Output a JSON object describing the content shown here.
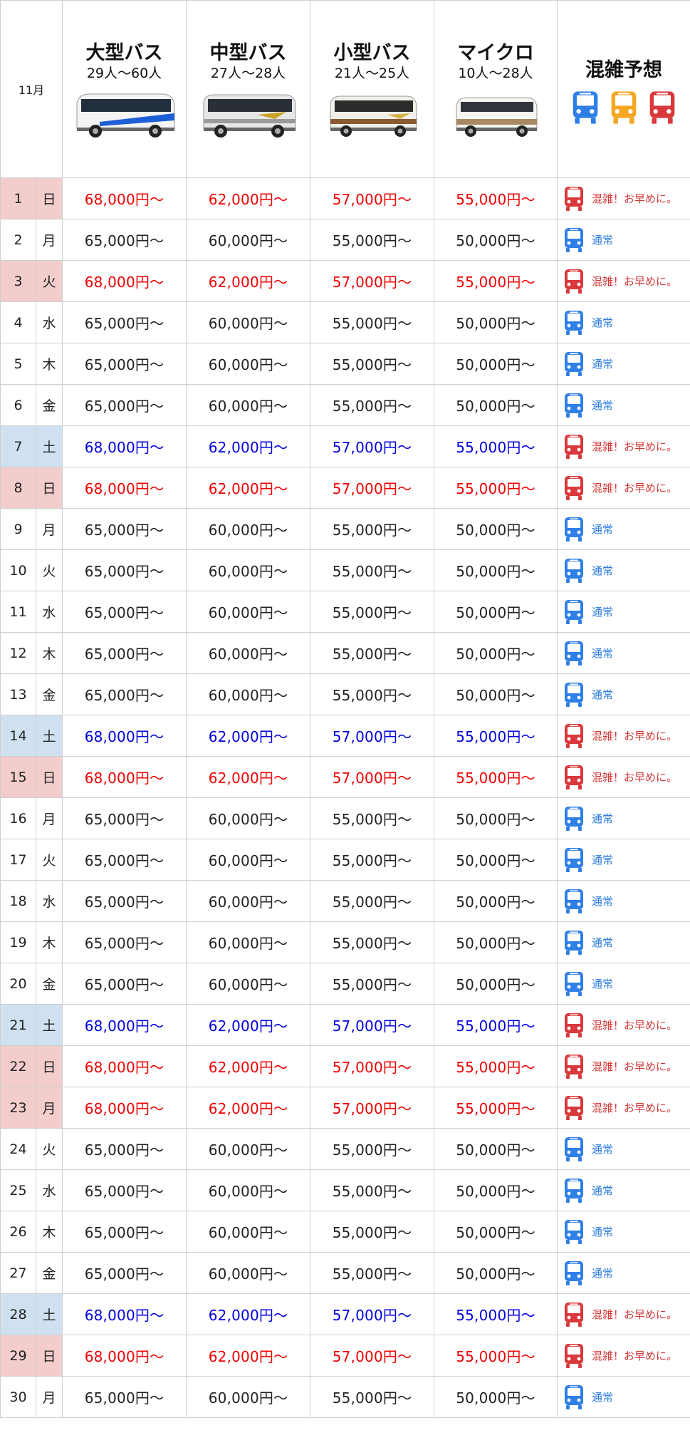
{
  "header": {
    "month": "11月",
    "congestion_title": "混雑予想",
    "buses": [
      {
        "name": "大型バス",
        "capacity": "29人〜60人"
      },
      {
        "name": "中型バス",
        "capacity": "27人〜28人"
      },
      {
        "name": "小型バス",
        "capacity": "21人〜25人"
      },
      {
        "name": "マイクロ",
        "capacity": "10人〜28人"
      }
    ],
    "legend_colors": [
      "#2f80e6",
      "#f5a623",
      "#d9393c"
    ]
  },
  "price_sets": {
    "busy": [
      "68,000円〜",
      "62,000円〜",
      "57,000円〜",
      "55,000円〜"
    ],
    "normal": [
      "65,000円〜",
      "60,000円〜",
      "55,000円〜",
      "50,000円〜"
    ]
  },
  "status_labels": {
    "busy": "混雑！お早めに。",
    "normal": "通常"
  },
  "colors": {
    "sunday_holiday_text": "#f00000",
    "saturday_text": "#0000e0",
    "sunday_holiday_bg": "#f3cccc",
    "saturday_bg": "#cfe1f1",
    "busy_icon": "#d9393c",
    "normal_icon": "#2f80e6"
  },
  "days": [
    {
      "day": "1",
      "weekday": "日",
      "type": "sun"
    },
    {
      "day": "2",
      "weekday": "月",
      "type": "normal"
    },
    {
      "day": "3",
      "weekday": "火",
      "type": "sun"
    },
    {
      "day": "4",
      "weekday": "水",
      "type": "normal"
    },
    {
      "day": "5",
      "weekday": "木",
      "type": "normal"
    },
    {
      "day": "6",
      "weekday": "金",
      "type": "normal"
    },
    {
      "day": "7",
      "weekday": "土",
      "type": "sat"
    },
    {
      "day": "8",
      "weekday": "日",
      "type": "sun"
    },
    {
      "day": "9",
      "weekday": "月",
      "type": "normal"
    },
    {
      "day": "10",
      "weekday": "火",
      "type": "normal"
    },
    {
      "day": "11",
      "weekday": "水",
      "type": "normal"
    },
    {
      "day": "12",
      "weekday": "木",
      "type": "normal"
    },
    {
      "day": "13",
      "weekday": "金",
      "type": "normal"
    },
    {
      "day": "14",
      "weekday": "土",
      "type": "sat"
    },
    {
      "day": "15",
      "weekday": "日",
      "type": "sun"
    },
    {
      "day": "16",
      "weekday": "月",
      "type": "normal"
    },
    {
      "day": "17",
      "weekday": "火",
      "type": "normal"
    },
    {
      "day": "18",
      "weekday": "水",
      "type": "normal"
    },
    {
      "day": "19",
      "weekday": "木",
      "type": "normal"
    },
    {
      "day": "20",
      "weekday": "金",
      "type": "normal"
    },
    {
      "day": "21",
      "weekday": "土",
      "type": "sat"
    },
    {
      "day": "22",
      "weekday": "日",
      "type": "sun"
    },
    {
      "day": "23",
      "weekday": "月",
      "type": "sun"
    },
    {
      "day": "24",
      "weekday": "火",
      "type": "normal"
    },
    {
      "day": "25",
      "weekday": "水",
      "type": "normal"
    },
    {
      "day": "26",
      "weekday": "木",
      "type": "normal"
    },
    {
      "day": "27",
      "weekday": "金",
      "type": "normal"
    },
    {
      "day": "28",
      "weekday": "土",
      "type": "sat"
    },
    {
      "day": "29",
      "weekday": "日",
      "type": "sun"
    },
    {
      "day": "30",
      "weekday": "月",
      "type": "normal"
    }
  ]
}
